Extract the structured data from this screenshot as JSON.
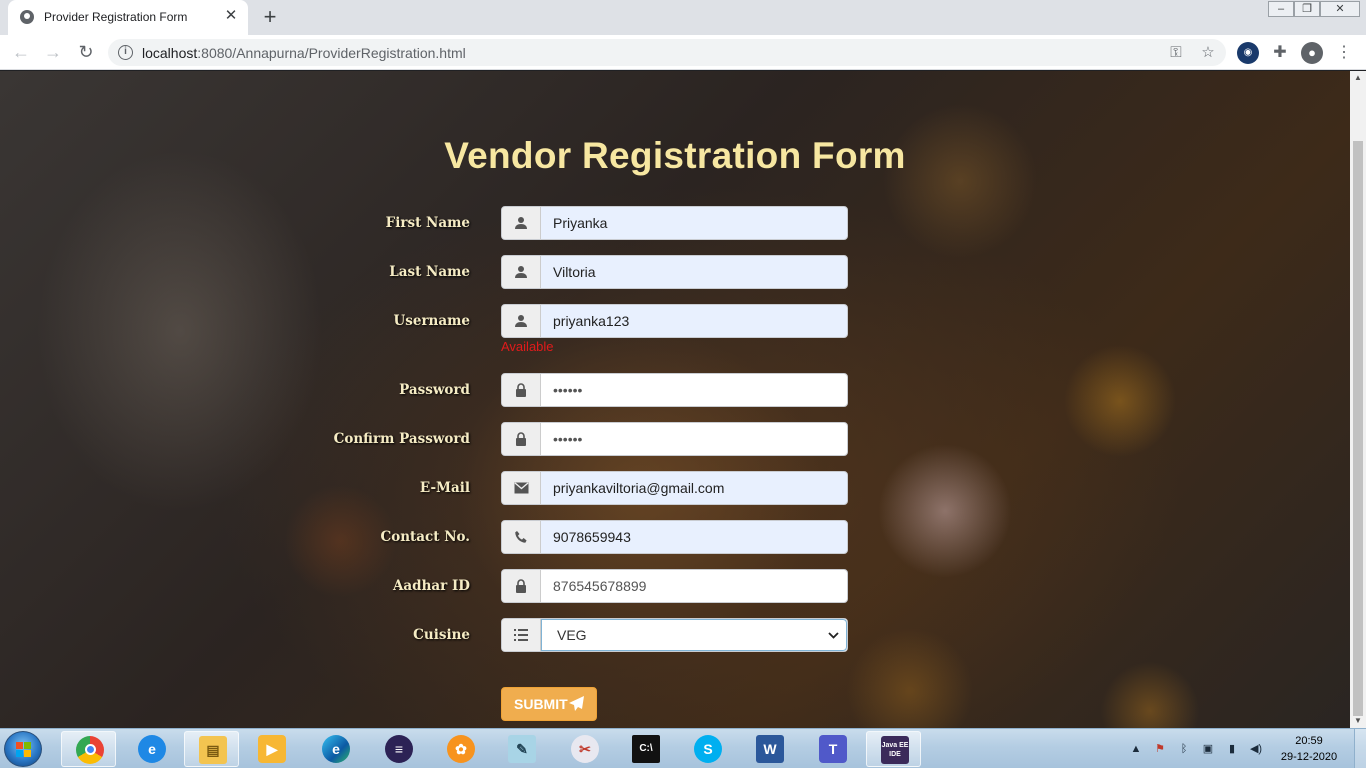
{
  "browser": {
    "tab_title": "Provider Registration Form",
    "tab_close": "✕",
    "new_tab": "+",
    "url_host": "localhost",
    "url_path": ":8080/Annapurna/ProviderRegistration.html",
    "icons": [
      "back-icon",
      "forward-icon",
      "reload-icon",
      "site-info-icon",
      "key-icon",
      "star-icon",
      "extension-icon",
      "puzzle-icon",
      "profile-icon",
      "menu-icon"
    ]
  },
  "form": {
    "title": "Vendor Registration Form",
    "fields": [
      {
        "label": "First Name",
        "value": "Priyanka",
        "icon": "user-icon"
      },
      {
        "label": "Last Name",
        "value": "Viltoria",
        "icon": "user-icon"
      },
      {
        "label": "Username",
        "value": "priyanka123",
        "icon": "user-icon"
      },
      {
        "label": "Password",
        "value": "••••••",
        "icon": "lock-icon"
      },
      {
        "label": "Confirm Password",
        "value": "••••••",
        "icon": "lock-icon"
      },
      {
        "label": "E-Mail",
        "value": "priyankaviltoria@gmail.com",
        "icon": "envelope-icon"
      },
      {
        "label": "Contact No.",
        "value": "9078659943",
        "icon": "phone-icon"
      },
      {
        "label": "Aadhar ID",
        "value": "876545678899",
        "icon": "lock-icon"
      },
      {
        "label": "Cuisine",
        "value": "VEG",
        "icon": "list-icon"
      }
    ],
    "username_status": "Available",
    "username_status_color": "#e01b1b",
    "submit_label": "SUBMIT"
  },
  "taskbar": {
    "apps": [
      "chrome",
      "internet-explorer",
      "file-explorer",
      "media-player",
      "edge",
      "eclipse",
      "app-flower",
      "notepad",
      "snipping-tool",
      "command-prompt",
      "skype",
      "word",
      "teams",
      "java-ee-ide"
    ],
    "javaee_label": "Java EE IDE",
    "time": "20:59",
    "date": "29-12-2020"
  },
  "colors": {
    "title": "#f7e7a1",
    "label": "#f6ecc4",
    "submit": "#f0ad4e",
    "autofill": "#e8f0fe"
  }
}
